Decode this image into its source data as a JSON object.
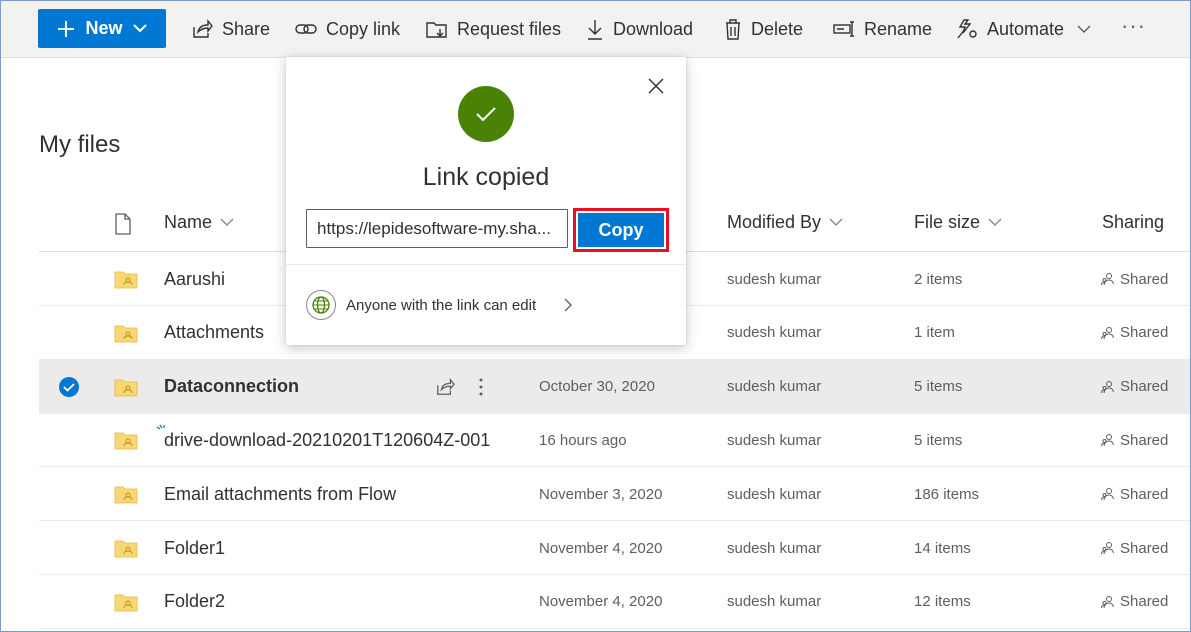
{
  "toolbar": {
    "new_label": "New",
    "share_label": "Share",
    "copy_link_label": "Copy link",
    "request_files_label": "Request files",
    "download_label": "Download",
    "delete_label": "Delete",
    "rename_label": "Rename",
    "automate_label": "Automate",
    "more_label": "···"
  },
  "page": {
    "title": "My files"
  },
  "columns": {
    "name": "Name",
    "modified_by": "Modified By",
    "file_size": "File size",
    "sharing": "Sharing"
  },
  "rows": [
    {
      "name": "Aarushi",
      "modified": "",
      "modified_by": "sudesh kumar",
      "size": "2 items",
      "sharing": "Shared"
    },
    {
      "name": "Attachments",
      "modified": "",
      "modified_by": "sudesh kumar",
      "size": "1 item",
      "sharing": "Shared"
    },
    {
      "name": "Dataconnection",
      "modified": "October 30, 2020",
      "modified_by": "sudesh kumar",
      "size": "5 items",
      "sharing": "Shared"
    },
    {
      "name": "drive-download-20210201T120604Z-001",
      "modified": "16 hours ago",
      "modified_by": "sudesh kumar",
      "size": "5 items",
      "sharing": "Shared"
    },
    {
      "name": "Email attachments from Flow",
      "modified": "November 3, 2020",
      "modified_by": "sudesh kumar",
      "size": "186 items",
      "sharing": "Shared"
    },
    {
      "name": "Folder1",
      "modified": "November 4, 2020",
      "modified_by": "sudesh kumar",
      "size": "14 items",
      "sharing": "Shared"
    },
    {
      "name": "Folder2",
      "modified": "November 4, 2020",
      "modified_by": "sudesh kumar",
      "size": "12 items",
      "sharing": "Shared"
    }
  ],
  "popup": {
    "heading": "Link copied",
    "link_value": "https://lepidesoftware-my.sha...",
    "copy_label": "Copy",
    "permission_text": "Anyone with the link can edit"
  },
  "colors": {
    "accent": "#0078d4",
    "success": "#498205",
    "highlight": "#e81123"
  }
}
